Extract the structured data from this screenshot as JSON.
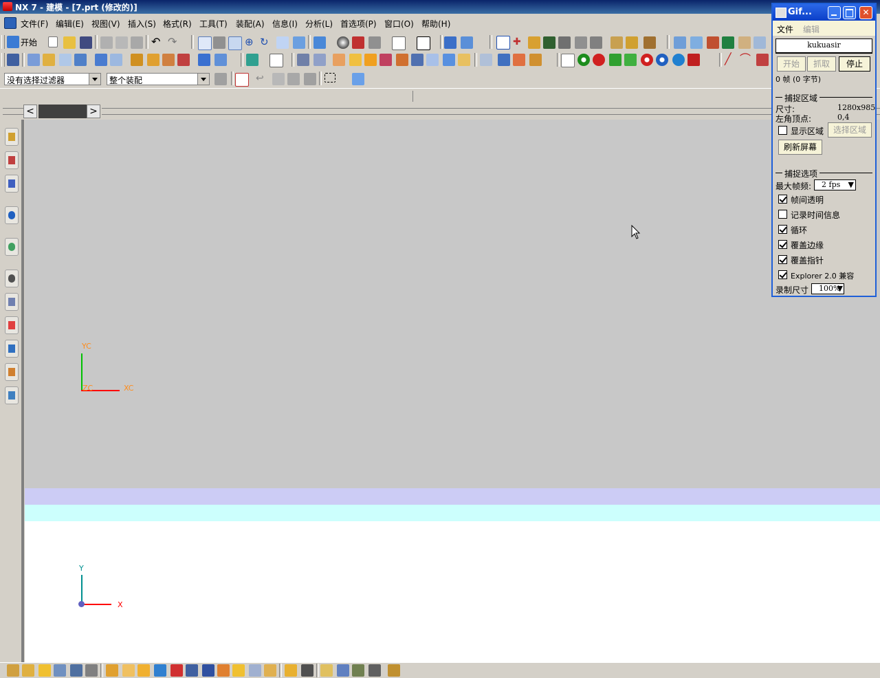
{
  "window": {
    "title": "NX 7 - 建模 - [7.prt (修改的)]"
  },
  "menu": {
    "items": [
      "文件(F)",
      "编辑(E)",
      "视图(V)",
      "插入(S)",
      "格式(R)",
      "工具(T)",
      "装配(A)",
      "信息(I)",
      "分析(L)",
      "首选项(P)",
      "窗口(O)",
      "帮助(H)"
    ]
  },
  "toolbar": {
    "start_label": "开始"
  },
  "filters": {
    "selection_filter": "没有选择过滤器",
    "assembly_scope": "整个装配"
  },
  "canvas": {
    "wcs": {
      "y": "YC",
      "x": "XC",
      "z": "ZC"
    },
    "absolute": {
      "y": "Y",
      "x": "X"
    },
    "colors": {
      "background": "#c8c8c8",
      "band1": "#ccccf5",
      "band2": "#ccfffd",
      "lower": "#ffffff"
    }
  },
  "gif_window": {
    "title": "Gif...",
    "menu": [
      "文件",
      "编辑"
    ],
    "user": "kukuasir",
    "buttons": {
      "start": "开始",
      "capture": "抓取",
      "stop": "停止"
    },
    "status": "0 帧 (0 字节)",
    "capture_area": {
      "heading": "捕捉区域",
      "size_label": "尺寸:",
      "size_value": "1280x985",
      "corner_label": "左角顶点:",
      "corner_value": "0,4",
      "show_area": "显示区域",
      "select_area": "选择区域",
      "refresh": "刷新屏幕"
    },
    "capture_options": {
      "heading": "捕捉选项",
      "max_fps_label": "最大帧频:",
      "max_fps_value": "2 fps",
      "checkboxes": [
        {
          "label": "帧间透明",
          "checked": true
        },
        {
          "label": "记录时间信息",
          "checked": false
        },
        {
          "label": "循环",
          "checked": true
        },
        {
          "label": "覆盖边缘",
          "checked": true
        },
        {
          "label": "覆盖指针",
          "checked": true
        },
        {
          "label": "Explorer 2.0 兼容",
          "checked": true
        }
      ],
      "record_size_label": "录制尺寸",
      "record_size_value": "100%"
    }
  }
}
